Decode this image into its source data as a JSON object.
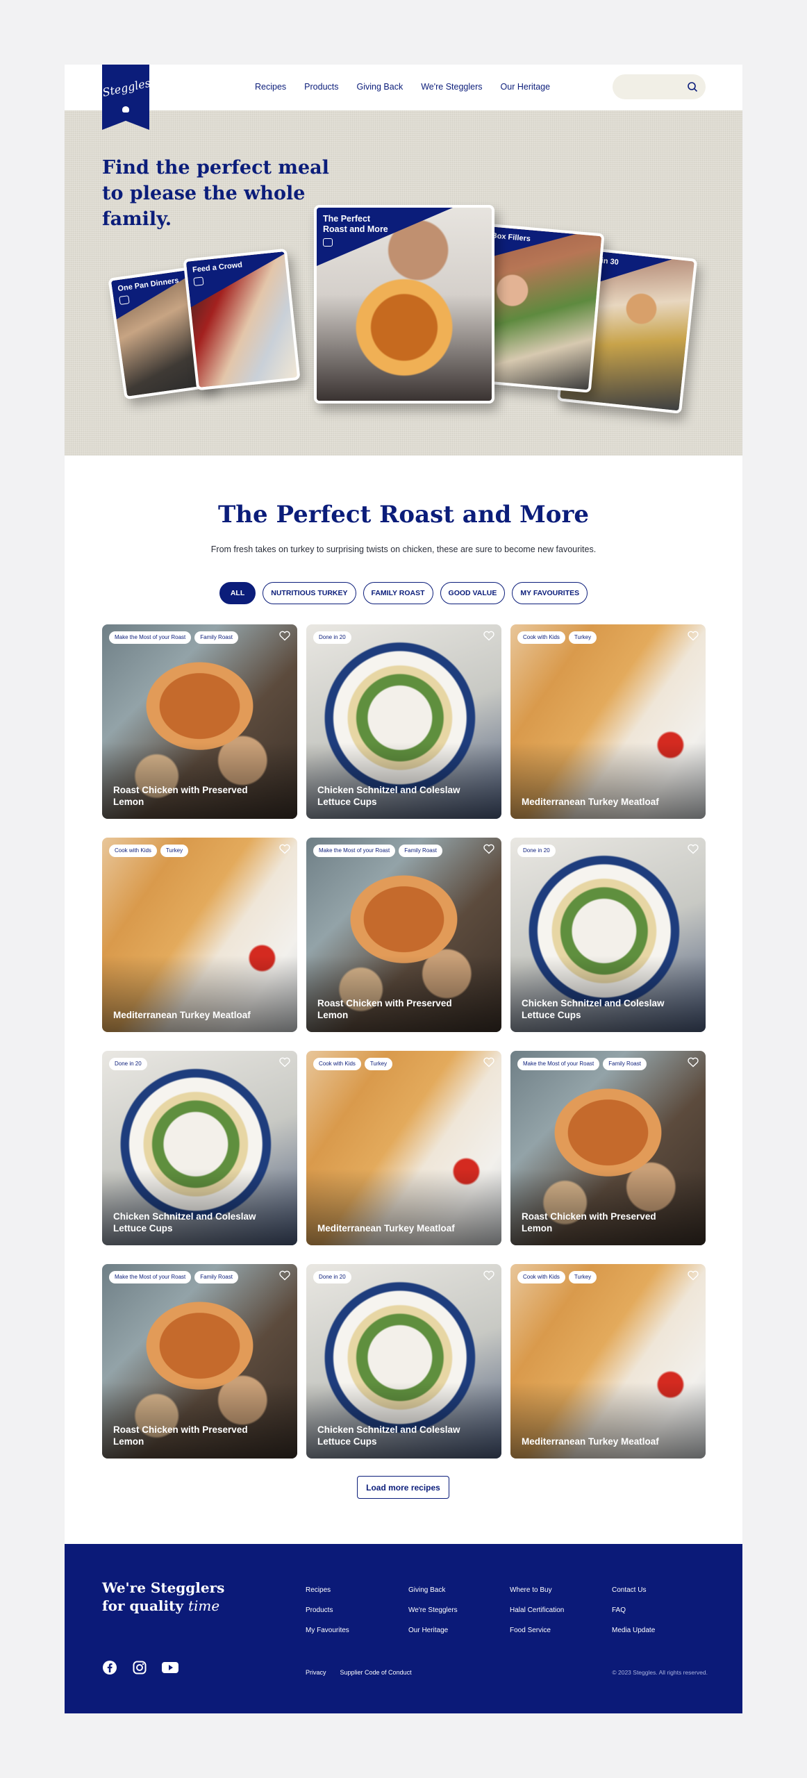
{
  "brand": {
    "logo_text": "Steggles",
    "color": "#0b1d7a"
  },
  "nav": [
    "Recipes",
    "Products",
    "Giving Back",
    "We're Stegglers",
    "Our Heritage"
  ],
  "hero": {
    "headline": "Find the perfect meal to please the whole family.",
    "cards": [
      "One Pan Dinners",
      "Feed a Crowd",
      "The Perfect Roast and More",
      "Lunch Box Fillers",
      "Done in 30"
    ]
  },
  "main": {
    "title": "The Perfect Roast and More",
    "subtitle": "From fresh takes on turkey to surprising twists on chicken, these are sure to become new favourites.",
    "filters": [
      "ALL",
      "NUTRITIOUS TURKEY",
      "FAMILY ROAST",
      "GOOD VALUE",
      "MY FAVOURITES"
    ],
    "active_filter": "ALL"
  },
  "recipes": [
    {
      "title": "Roast Chicken with Preserved Lemon",
      "tags": [
        "Make the Most of your Roast",
        "Family Roast"
      ],
      "image": "chicken"
    },
    {
      "title": "Chicken Schnitzel and Coleslaw Lettuce Cups",
      "tags": [
        "Done in 20"
      ],
      "image": "salad"
    },
    {
      "title": "Mediterranean Turkey Meatloaf",
      "tags": [
        "Cook with Kids",
        "Turkey"
      ],
      "image": "meatloaf"
    },
    {
      "title": "Mediterranean Turkey Meatloaf",
      "tags": [
        "Cook with Kids",
        "Turkey"
      ],
      "image": "meatloaf"
    },
    {
      "title": "Roast Chicken with Preserved Lemon",
      "tags": [
        "Make the Most of your Roast",
        "Family Roast"
      ],
      "image": "chicken"
    },
    {
      "title": "Chicken Schnitzel and Coleslaw Lettuce Cups",
      "tags": [
        "Done in 20"
      ],
      "image": "salad"
    },
    {
      "title": "Chicken Schnitzel and Coleslaw Lettuce Cups",
      "tags": [
        "Done in 20"
      ],
      "image": "salad"
    },
    {
      "title": "Mediterranean Turkey Meatloaf",
      "tags": [
        "Cook with Kids",
        "Turkey"
      ],
      "image": "meatloaf"
    },
    {
      "title": "Roast Chicken with Preserved Lemon",
      "tags": [
        "Make the Most of your Roast",
        "Family Roast"
      ],
      "image": "chicken"
    },
    {
      "title": "Roast Chicken with Preserved Lemon",
      "tags": [
        "Make the Most of your Roast",
        "Family Roast"
      ],
      "image": "chicken"
    },
    {
      "title": "Chicken Schnitzel and Coleslaw Lettuce Cups",
      "tags": [
        "Done in 20"
      ],
      "image": "salad"
    },
    {
      "title": "Mediterranean Turkey Meatloaf",
      "tags": [
        "Cook with Kids",
        "Turkey"
      ],
      "image": "meatloaf"
    }
  ],
  "load_more": "Load more recipes",
  "footer": {
    "tagline_main": "We're Stegglers for quality",
    "tagline_script": "time",
    "columns": [
      [
        "Recipes",
        "Products",
        "My Favourites"
      ],
      [
        "Giving Back",
        "We're Stegglers",
        "Our Heritage"
      ],
      [
        "Where to Buy",
        "Halal Certification",
        "Food Service"
      ],
      [
        "Contact Us",
        "FAQ",
        "Media Update"
      ]
    ],
    "legal": [
      "Privacy",
      "Supplier Code of Conduct"
    ],
    "copyright": "© 2023 Steggles. All rights reserved.",
    "social": [
      "facebook-icon",
      "instagram-icon",
      "youtube-icon"
    ]
  }
}
